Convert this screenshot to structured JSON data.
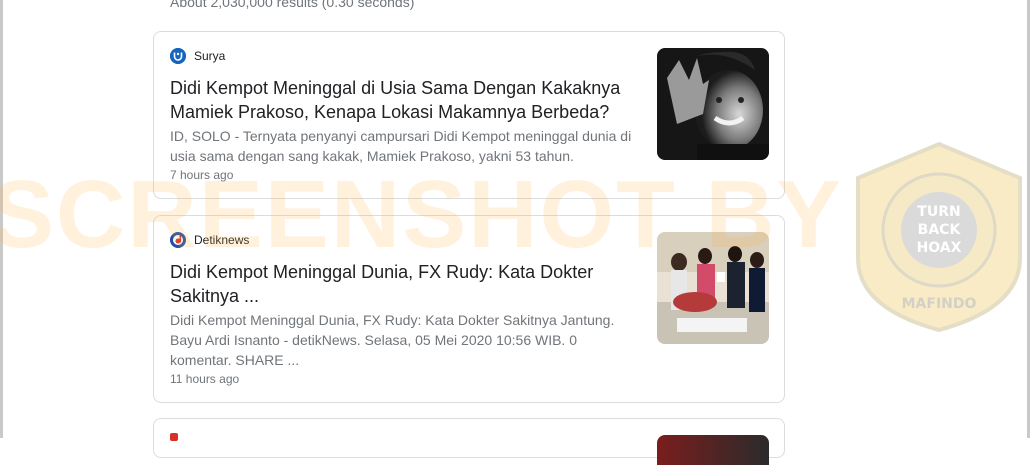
{
  "results_stats": "About 2,030,000 results (0.30 seconds)",
  "results": [
    {
      "source": "Surya",
      "favicon_color": "#1565c0",
      "title": "Didi Kempot Meninggal di Usia Sama Dengan Kakaknya Mamiek Prakoso, Kenapa Lokasi Makamnya Berbeda?",
      "snippet": "ID, SOLO - Ternyata penyanyi campursari Didi Kempot meninggal dunia di usia sama dengan sang kakak, Mamiek Prakoso, yakni 53 tahun.",
      "time": "7 hours ago"
    },
    {
      "source": "Detiknews",
      "favicon_color": "#1e4fa8",
      "title": "Didi Kempot Meninggal Dunia, FX Rudy: Kata Dokter Sakitnya ...",
      "snippet": "Didi Kempot Meninggal Dunia, FX Rudy: Kata Dokter Sakitnya Jantung. Bayu Ardi Isnanto - detikNews. Selasa, 05 Mei 2020 10:56 WIB. 0 komentar. SHARE ...",
      "time": "11 hours ago"
    }
  ],
  "watermark": {
    "text": "SCREENSHOT BY",
    "seal_top": "TURN",
    "seal_mid": "BACK",
    "seal_bottom": "HOAX",
    "seal_ring": "MASYARAKAT ANTI FITNAH INDONESIA",
    "seal_org": "MAFINDO"
  }
}
